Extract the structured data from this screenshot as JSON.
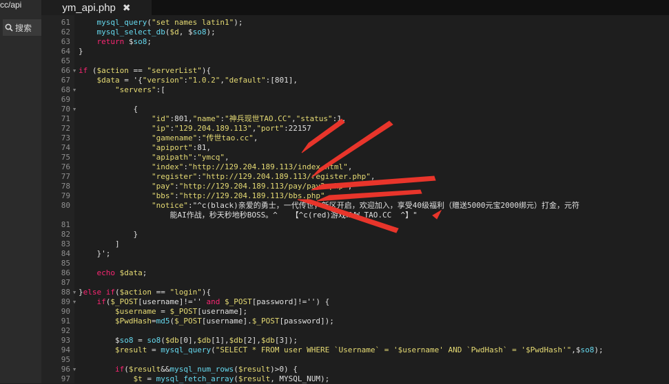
{
  "left_panel": {
    "path": "cc/api",
    "search_label": "搜索",
    "collapse_glyph": "‹"
  },
  "tab": {
    "title": "ym_api.php",
    "close_glyph": "✖"
  },
  "colors": {
    "bg": "#1e1e1e",
    "keyword": "#f92672",
    "function": "#66d9ef",
    "string": "#e6db74",
    "number": "#ae81ff",
    "annotation": "#e8352b"
  },
  "code_lines": [
    {
      "n": "61",
      "fold": "",
      "text": "    mysql_query(\"set names latin1\");"
    },
    {
      "n": "62",
      "fold": "",
      "text": "    mysql_select_db($d, $so8);"
    },
    {
      "n": "63",
      "fold": "",
      "text": "    return $so8;"
    },
    {
      "n": "64",
      "fold": "",
      "text": "}"
    },
    {
      "n": "65",
      "fold": "",
      "text": ""
    },
    {
      "n": "66",
      "fold": "▾",
      "text": "if ($action == \"serverList\"){"
    },
    {
      "n": "67",
      "fold": "",
      "text": "    $data = '{\"version\":\"1.0.2\",\"default\":[801],"
    },
    {
      "n": "68",
      "fold": "▾",
      "text": "        \"servers\":["
    },
    {
      "n": "69",
      "fold": "",
      "text": ""
    },
    {
      "n": "70",
      "fold": "▾",
      "text": "            {"
    },
    {
      "n": "71",
      "fold": "",
      "text": "                \"id\":801,\"name\":\"神兵现世TAO.CC\",\"status\":1,"
    },
    {
      "n": "72",
      "fold": "",
      "text": "                \"ip\":\"129.204.189.113\",\"port\":22157"
    },
    {
      "n": "73",
      "fold": "",
      "text": "                \"gamename\":\"传世tao.cc\","
    },
    {
      "n": "74",
      "fold": "",
      "text": "                \"apiport\":81,"
    },
    {
      "n": "75",
      "fold": "",
      "text": "                \"apipath\":\"ymcq\","
    },
    {
      "n": "76",
      "fold": "",
      "text": "                \"index\":\"http://129.204.189.113/index.html\","
    },
    {
      "n": "77",
      "fold": "",
      "text": "                \"register\":\"http://129.204.189.113/register.php\","
    },
    {
      "n": "78",
      "fold": "",
      "text": "                \"pay\":\"http://129.204.189.113/pay/pay2.php\","
    },
    {
      "n": "79",
      "fold": "",
      "text": "                \"bbs\":\"http://129.204.189.113/bbs.php\","
    },
    {
      "n": "80",
      "fold": "",
      "text": "                \"notice\":\"^c(black)亲爱的勇士，一代传世，新区开启，欢迎加入，享受40级福利（赠送5000元宝2000绑元）打金，元符"
    },
    {
      "n": "",
      "fold": "",
      "text": "                    能AI作战，秒天秒地秒BOSS。^   【^c(red)游戏WWW.TAO.CC  ^】\""
    },
    {
      "n": "81",
      "fold": "",
      "text": ""
    },
    {
      "n": "82",
      "fold": "",
      "text": "            }"
    },
    {
      "n": "83",
      "fold": "",
      "text": "        ]"
    },
    {
      "n": "84",
      "fold": "",
      "text": "    }';"
    },
    {
      "n": "85",
      "fold": "",
      "text": ""
    },
    {
      "n": "86",
      "fold": "",
      "text": "    echo $data;"
    },
    {
      "n": "87",
      "fold": "",
      "text": ""
    },
    {
      "n": "88",
      "fold": "▾",
      "text": "}else if($action == \"login\"){"
    },
    {
      "n": "89",
      "fold": "▾",
      "text": "    if($_POST[username]!='' and $_POST[password]!='') {"
    },
    {
      "n": "90",
      "fold": "",
      "text": "        $username = $_POST[username];"
    },
    {
      "n": "91",
      "fold": "",
      "text": "        $PwdHash=md5($_POST[username].$_POST[password]);"
    },
    {
      "n": "92",
      "fold": "",
      "text": ""
    },
    {
      "n": "93",
      "fold": "",
      "text": "        $so8 = so8($db[0],$db[1],$db[2],$db[3]);"
    },
    {
      "n": "94",
      "fold": "",
      "text": "        $result = mysql_query(\"SELECT * FROM user WHERE `Username` = '$username' AND `PwdHash` = '$PwdHash'\",$so8);"
    },
    {
      "n": "95",
      "fold": "",
      "text": ""
    },
    {
      "n": "96",
      "fold": "▾",
      "text": "        if($result&&mysql_num_rows($result)>0) {"
    },
    {
      "n": "97",
      "fold": "",
      "text": "            $t = mysql_fetch_array($result, MYSQL_NUM);"
    }
  ]
}
